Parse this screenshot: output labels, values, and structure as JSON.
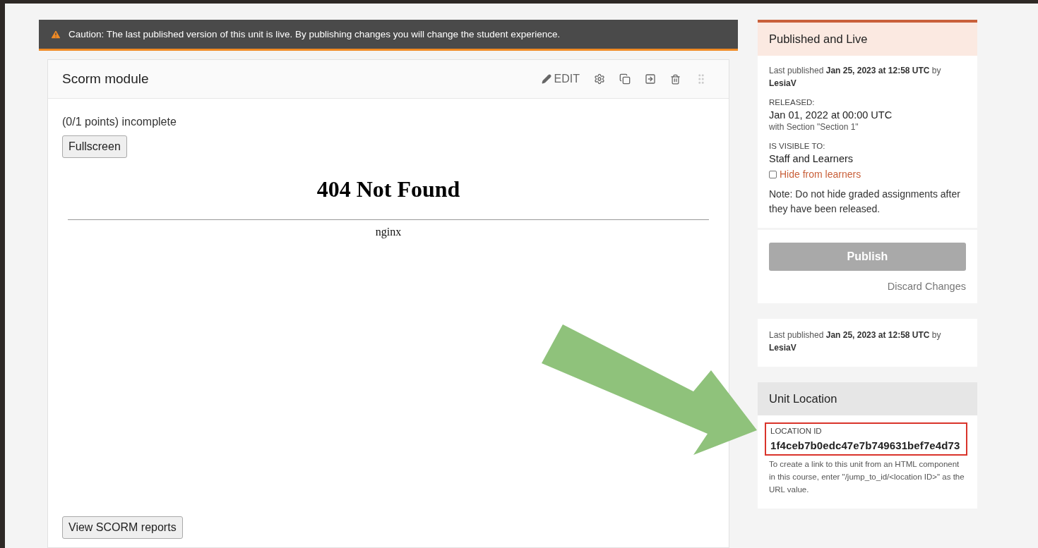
{
  "caution": {
    "text": "Caution: The last published version of this unit is live. By publishing changes you will change the student experience."
  },
  "module": {
    "title": "Scorm module",
    "edit_label": "EDIT",
    "score": "(0/1 points) incomplete",
    "fullscreen_button": "Fullscreen",
    "frame": {
      "heading": "404 Not Found",
      "server": "nginx"
    },
    "reports_button": "View SCORM reports"
  },
  "sidebar": {
    "status": {
      "title": "Published and Live",
      "last_published": "Last published **Jan 25, 2023 at 12:58 UTC** by **LesiaV**",
      "released_label": "RELEASED:",
      "release_date": "Jan 01, 2022 at 00:00 UTC",
      "release_note": "with Section \"Section 1\"",
      "visibility_label": "IS VISIBLE TO:",
      "visibility": "Staff and Learners",
      "hide_checkbox": {
        "label": "Hide from learners",
        "checked": false
      },
      "note": "Note: Do not hide graded assignments after they have been released.",
      "publish_button": {
        "label": "Publish",
        "disabled": true
      },
      "discard_link": "Discard Changes"
    },
    "history": {
      "last_published": "Last published **Jan 25, 2023 at 12:58 UTC** by **LesiaV**"
    },
    "unit_location": {
      "title": "Unit Location",
      "id_label": "LOCATION ID",
      "id": "1f4ceb7b0edc47e7b749631bef7e4d73",
      "highlighted": true,
      "help": "To create a link to this unit from an HTML component in this course, enter \"/jump_to_id/<location ID>\" as the URL value."
    }
  }
}
